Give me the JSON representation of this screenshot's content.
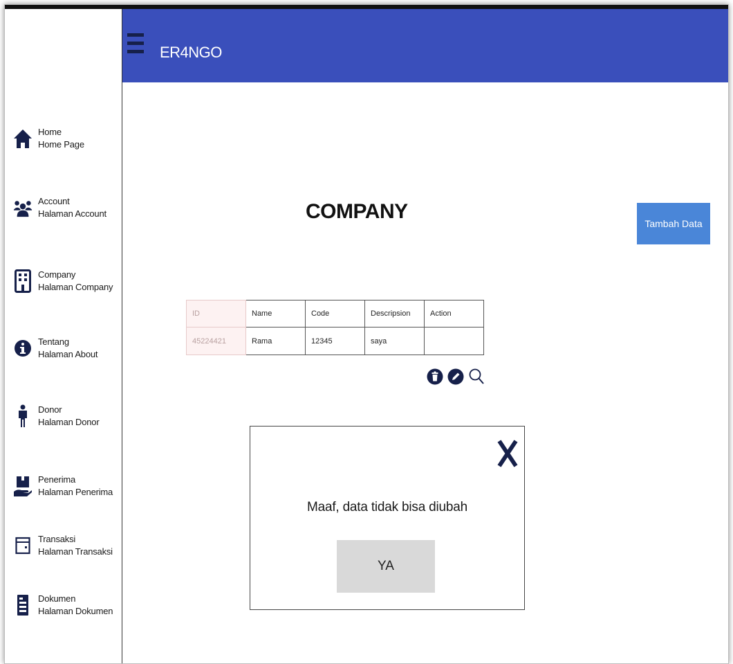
{
  "app": {
    "title": "ER4NGO"
  },
  "sidebar": {
    "items": [
      {
        "label": "Home",
        "sublabel": "Home Page",
        "icon": "home-icon"
      },
      {
        "label": "Account",
        "sublabel": "Halaman Account",
        "icon": "users-icon"
      },
      {
        "label": "Company",
        "sublabel": "Halaman Company",
        "icon": "building-icon"
      },
      {
        "label": "Tentang",
        "sublabel": "Halaman About",
        "icon": "info-icon"
      },
      {
        "label": "Donor",
        "sublabel": "Halaman Donor",
        "icon": "person-icon"
      },
      {
        "label": "Penerima",
        "sublabel": "Halaman Penerima",
        "icon": "hand-box-icon"
      },
      {
        "label": "Transaksi",
        "sublabel": "Halaman Transaksi",
        "icon": "wallet-icon"
      },
      {
        "label": "Dokumen",
        "sublabel": "Halaman Dokumen",
        "icon": "document-icon"
      }
    ]
  },
  "main": {
    "title": "COMPANY",
    "add_button": "Tambah Data",
    "table": {
      "headers": [
        "ID",
        "Name",
        "Code",
        "Descripsion",
        "Action"
      ],
      "rows": [
        [
          "45224421",
          "Rama",
          "12345",
          "saya",
          ""
        ]
      ]
    },
    "actions": [
      "trash-icon",
      "edit-icon",
      "search-icon"
    ]
  },
  "dialog": {
    "message": "Maaf, data tidak bisa diubah",
    "confirm": "YA"
  },
  "colors": {
    "header": "#3a4fbb",
    "accent_button": "#4a86d8",
    "icon": "#16204a",
    "dialog_button": "#d9d9d9"
  }
}
